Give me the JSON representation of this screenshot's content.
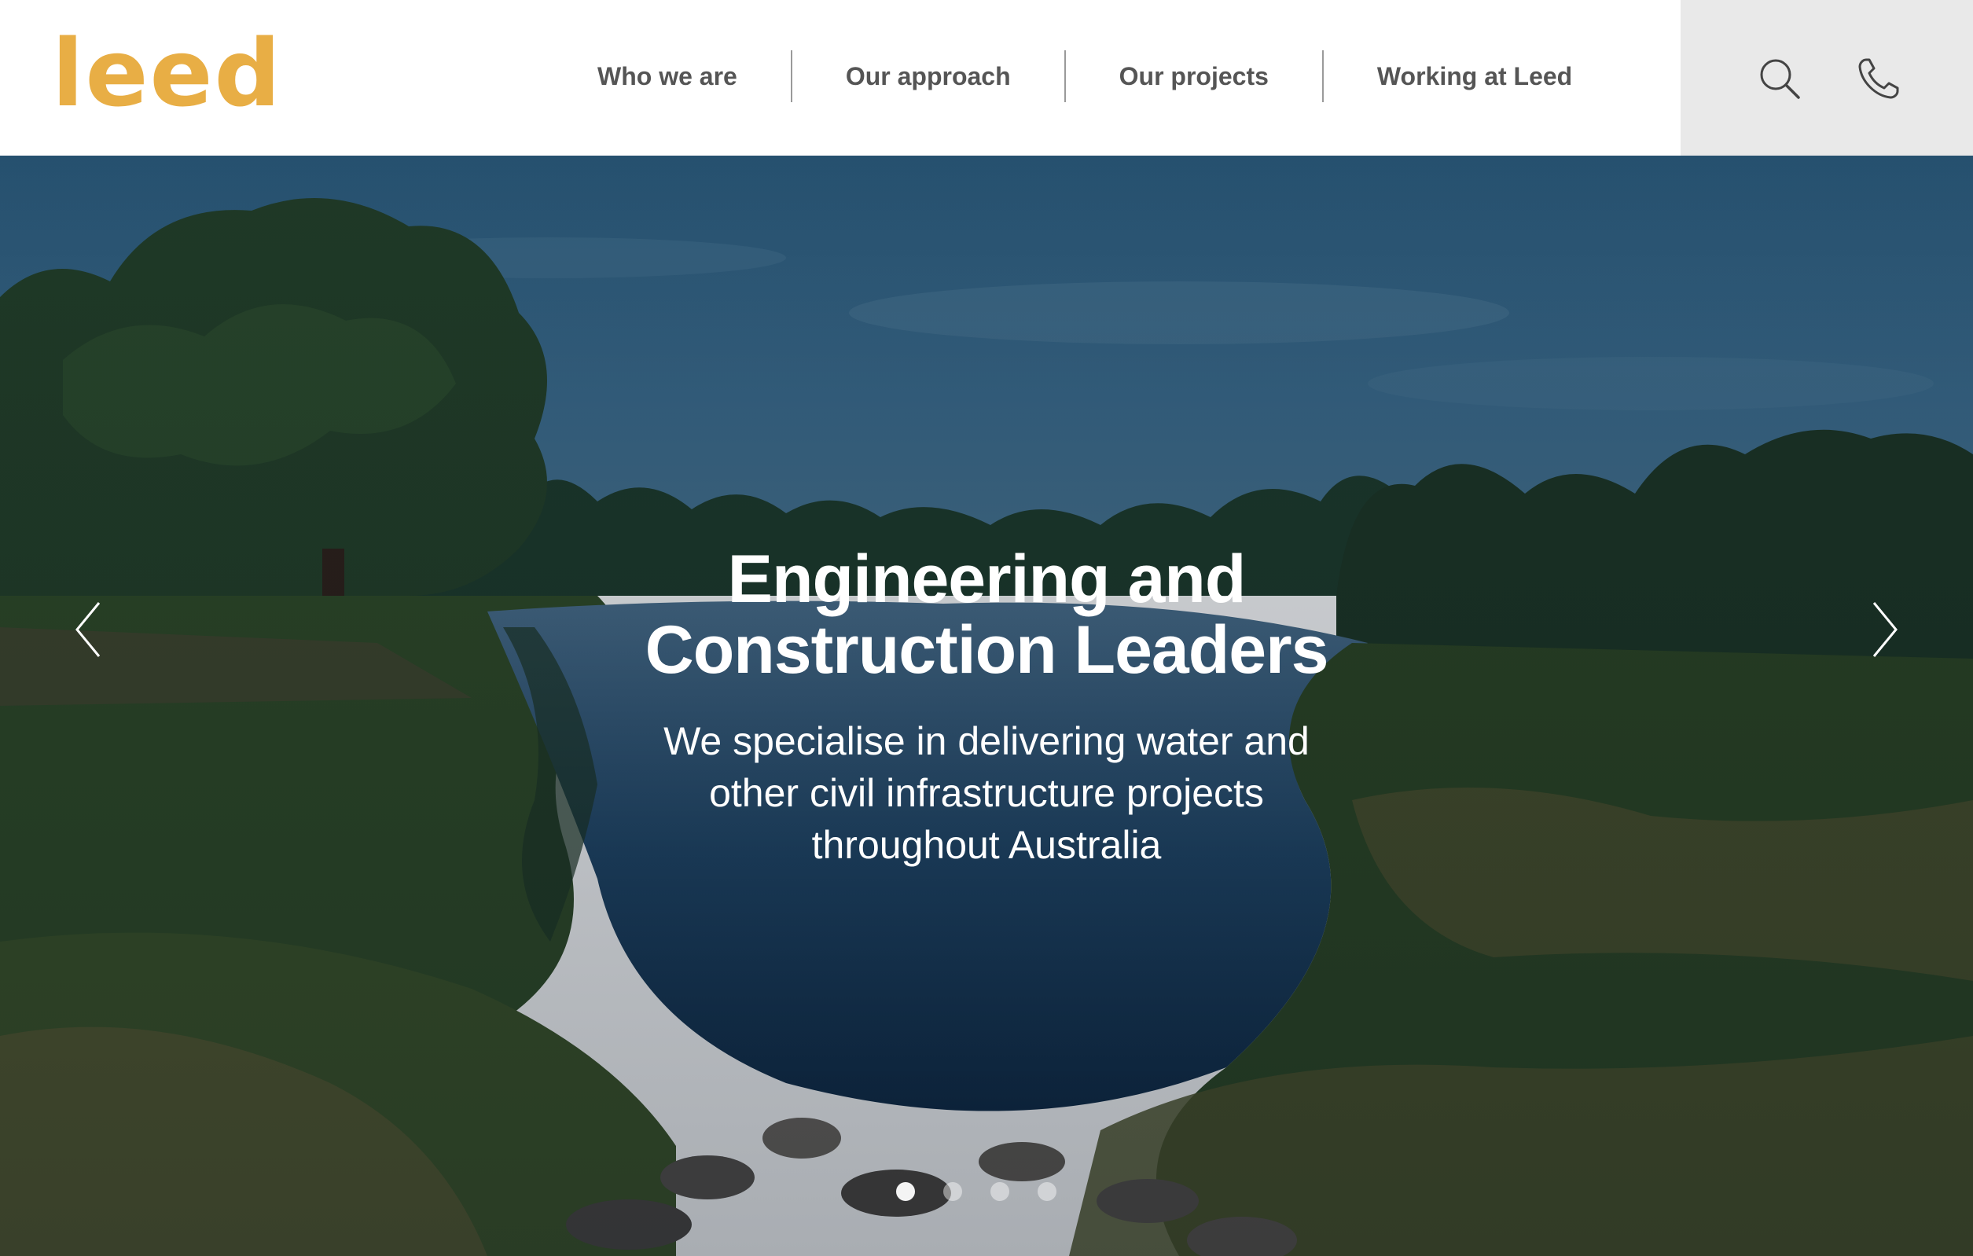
{
  "brand": {
    "logo_text": "leed",
    "accent_color": "#E8AE45"
  },
  "nav": {
    "items": [
      {
        "label": "Who we are"
      },
      {
        "label": "Our approach"
      },
      {
        "label": "Our projects"
      },
      {
        "label": "Working at Leed"
      }
    ]
  },
  "tools": {
    "search_icon": "search-icon",
    "phone_icon": "phone-icon"
  },
  "hero": {
    "title_line1": "Engineering and",
    "title_line2": "Construction Leaders",
    "subtitle_line1": "We specialise in delivering water and",
    "subtitle_line2": "other civil infrastructure projects",
    "subtitle_line3": "throughout Australia",
    "prev_icon": "chevron-left-icon",
    "next_icon": "chevron-right-icon",
    "slides_total": 4,
    "active_slide": 1
  }
}
